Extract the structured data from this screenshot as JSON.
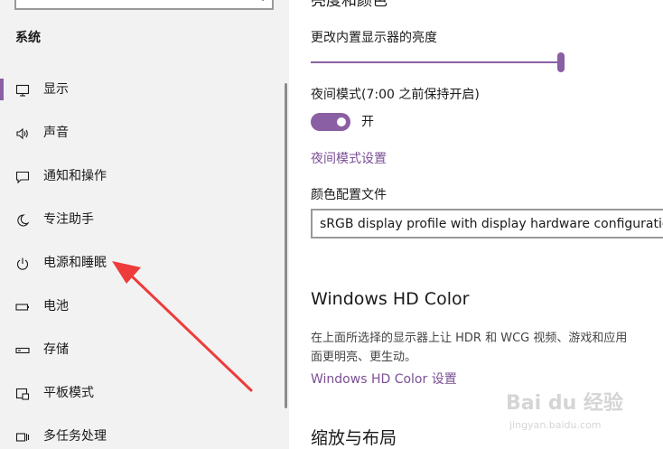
{
  "sidebar": {
    "heading": "系统",
    "items": [
      {
        "label": "显示",
        "icon": "monitor-icon",
        "selected": true
      },
      {
        "label": "声音",
        "icon": "speaker-icon",
        "selected": false
      },
      {
        "label": "通知和操作",
        "icon": "notification-icon",
        "selected": false
      },
      {
        "label": "专注助手",
        "icon": "moon-icon",
        "selected": false
      },
      {
        "label": "电源和睡眠",
        "icon": "power-icon",
        "selected": false
      },
      {
        "label": "电池",
        "icon": "battery-icon",
        "selected": false
      },
      {
        "label": "存储",
        "icon": "storage-icon",
        "selected": false
      },
      {
        "label": "平板模式",
        "icon": "tablet-mode-icon",
        "selected": false
      },
      {
        "label": "多任务处理",
        "icon": "multitask-icon",
        "selected": false
      }
    ]
  },
  "main": {
    "section_top_title": "亮度和颜色",
    "brightness": {
      "label": "更改内置显示器的亮度",
      "value_percent": 100
    },
    "night_light": {
      "label": "夜间模式(7:00 之前保持开启)",
      "state_label": "开",
      "on": true
    },
    "night_light_settings_link": "夜间模式设置",
    "color_profile": {
      "label": "颜色配置文件",
      "value": "sRGB display profile with display hardware configuration d"
    },
    "hd_color": {
      "title": "Windows HD Color",
      "description_line1": "在上面所选择的显示器上让 HDR 和 WCG 视频、游戏和应用",
      "description_line2": "面更明亮、更生动。",
      "link": "Windows HD Color 设置"
    },
    "scale_layout_title": "缩放与布局"
  },
  "watermark": {
    "logo": "Bai du 经验",
    "url": "jingyan.baidu.com"
  },
  "colors": {
    "accent": "#8a5fa3",
    "link": "#7b4f94",
    "arrow": "#ee3b3b",
    "sidebar_bg": "#f2f2f2"
  }
}
